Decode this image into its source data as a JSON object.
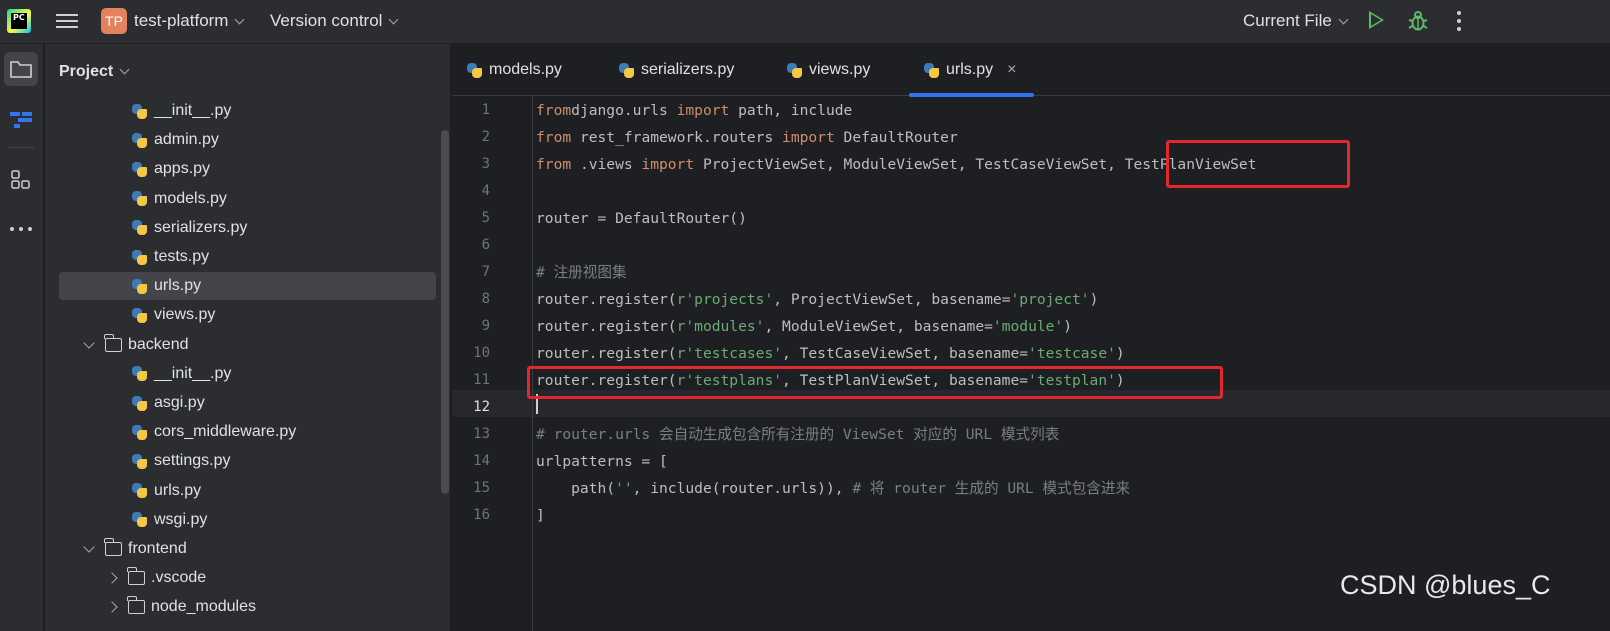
{
  "titlebar": {
    "project_badge": "TP",
    "project_name": "test-platform",
    "vcs": "Version control",
    "run_config": "Current File"
  },
  "project_panel": {
    "title": "Project",
    "tree": [
      {
        "label": "__init__.py",
        "type": "py",
        "depth": 2
      },
      {
        "label": "admin.py",
        "type": "py",
        "depth": 2
      },
      {
        "label": "apps.py",
        "type": "py",
        "depth": 2
      },
      {
        "label": "models.py",
        "type": "py",
        "depth": 2
      },
      {
        "label": "serializers.py",
        "type": "py",
        "depth": 2
      },
      {
        "label": "tests.py",
        "type": "py",
        "depth": 2
      },
      {
        "label": "urls.py",
        "type": "py",
        "depth": 2,
        "selected": true
      },
      {
        "label": "views.py",
        "type": "py",
        "depth": 2
      },
      {
        "label": "backend",
        "type": "folder",
        "depth": 1,
        "expanded": true
      },
      {
        "label": "__init__.py",
        "type": "py",
        "depth": 2
      },
      {
        "label": "asgi.py",
        "type": "py",
        "depth": 2
      },
      {
        "label": "cors_middleware.py",
        "type": "py",
        "depth": 2
      },
      {
        "label": "settings.py",
        "type": "py",
        "depth": 2
      },
      {
        "label": "urls.py",
        "type": "py",
        "depth": 2
      },
      {
        "label": "wsgi.py",
        "type": "py",
        "depth": 2
      },
      {
        "label": "frontend",
        "type": "folder",
        "depth": 1,
        "expanded": true
      },
      {
        "label": ".vscode",
        "type": "folder",
        "depth": 2,
        "expanded": false
      },
      {
        "label": "node_modules",
        "type": "folder",
        "depth": 2,
        "expanded": false
      }
    ]
  },
  "editor": {
    "tabs": [
      {
        "label": "models.py",
        "active": false
      },
      {
        "label": "serializers.py",
        "active": false
      },
      {
        "label": "views.py",
        "active": false
      },
      {
        "label": "urls.py",
        "active": true,
        "close": "×"
      }
    ],
    "current_line": 12,
    "lines": [
      {
        "n": "1",
        "tokens": [
          [
            "kw",
            "from"
          ],
          [
            "",
            "django.urls "
          ],
          [
            "kw",
            "import"
          ],
          [
            "",
            " path, include"
          ]
        ]
      },
      {
        "n": "2",
        "tokens": [
          [
            "kw",
            "from"
          ],
          [
            "",
            " rest_framework.routers "
          ],
          [
            "kw",
            "import"
          ],
          [
            "",
            " DefaultRouter"
          ]
        ]
      },
      {
        "n": "3",
        "tokens": [
          [
            "kw",
            "from"
          ],
          [
            "",
            " .views "
          ],
          [
            "kw",
            "import"
          ],
          [
            "",
            " ProjectViewSet, ModuleViewSet, TestCaseViewSet, TestPlanViewSet"
          ]
        ]
      },
      {
        "n": "4",
        "tokens": []
      },
      {
        "n": "5",
        "tokens": [
          [
            "",
            "router = DefaultRouter()"
          ]
        ]
      },
      {
        "n": "6",
        "tokens": []
      },
      {
        "n": "7",
        "tokens": [
          [
            "cm",
            "# 注册视图集"
          ]
        ]
      },
      {
        "n": "8",
        "tokens": [
          [
            "",
            "router.register("
          ],
          [
            "str",
            "r'projects'"
          ],
          [
            "",
            ", ProjectViewSet, basename="
          ],
          [
            "str",
            "'project'"
          ],
          [
            "",
            ")"
          ]
        ]
      },
      {
        "n": "9",
        "tokens": [
          [
            "",
            "router.register("
          ],
          [
            "str",
            "r'modules'"
          ],
          [
            "",
            ", ModuleViewSet, basename="
          ],
          [
            "str",
            "'module'"
          ],
          [
            "",
            ")"
          ]
        ]
      },
      {
        "n": "10",
        "tokens": [
          [
            "",
            "router.register("
          ],
          [
            "str",
            "r'testcases'"
          ],
          [
            "",
            ", TestCaseViewSet, basename="
          ],
          [
            "str",
            "'testcase'"
          ],
          [
            "",
            ")"
          ]
        ]
      },
      {
        "n": "11",
        "tokens": [
          [
            "",
            "router.register("
          ],
          [
            "str",
            "r'testplans'"
          ],
          [
            "",
            ", TestPlanViewSet, basename="
          ],
          [
            "str",
            "'testplan'"
          ],
          [
            "",
            ")"
          ]
        ]
      },
      {
        "n": "12",
        "tokens": []
      },
      {
        "n": "13",
        "tokens": [
          [
            "cm",
            "# router.urls 会自动生成包含所有注册的 ViewSet 对应的 URL 模式列表"
          ]
        ]
      },
      {
        "n": "14",
        "tokens": [
          [
            "",
            "urlpatterns = ["
          ]
        ]
      },
      {
        "n": "15",
        "tokens": [
          [
            "",
            "    path("
          ],
          [
            "str",
            "''"
          ],
          [
            "",
            ", include(router.urls)), "
          ],
          [
            "cm",
            "# 将 router 生成的 URL 模式包含进来"
          ]
        ]
      },
      {
        "n": "16",
        "tokens": [
          [
            "",
            "]"
          ]
        ]
      }
    ]
  },
  "watermark": "CSDN @blues_C",
  "colors": {
    "accent": "#3574f0",
    "highlight_box": "#e0282e",
    "keyword": "#cf8e6d",
    "string": "#6aab73",
    "comment": "#7a7e85"
  }
}
